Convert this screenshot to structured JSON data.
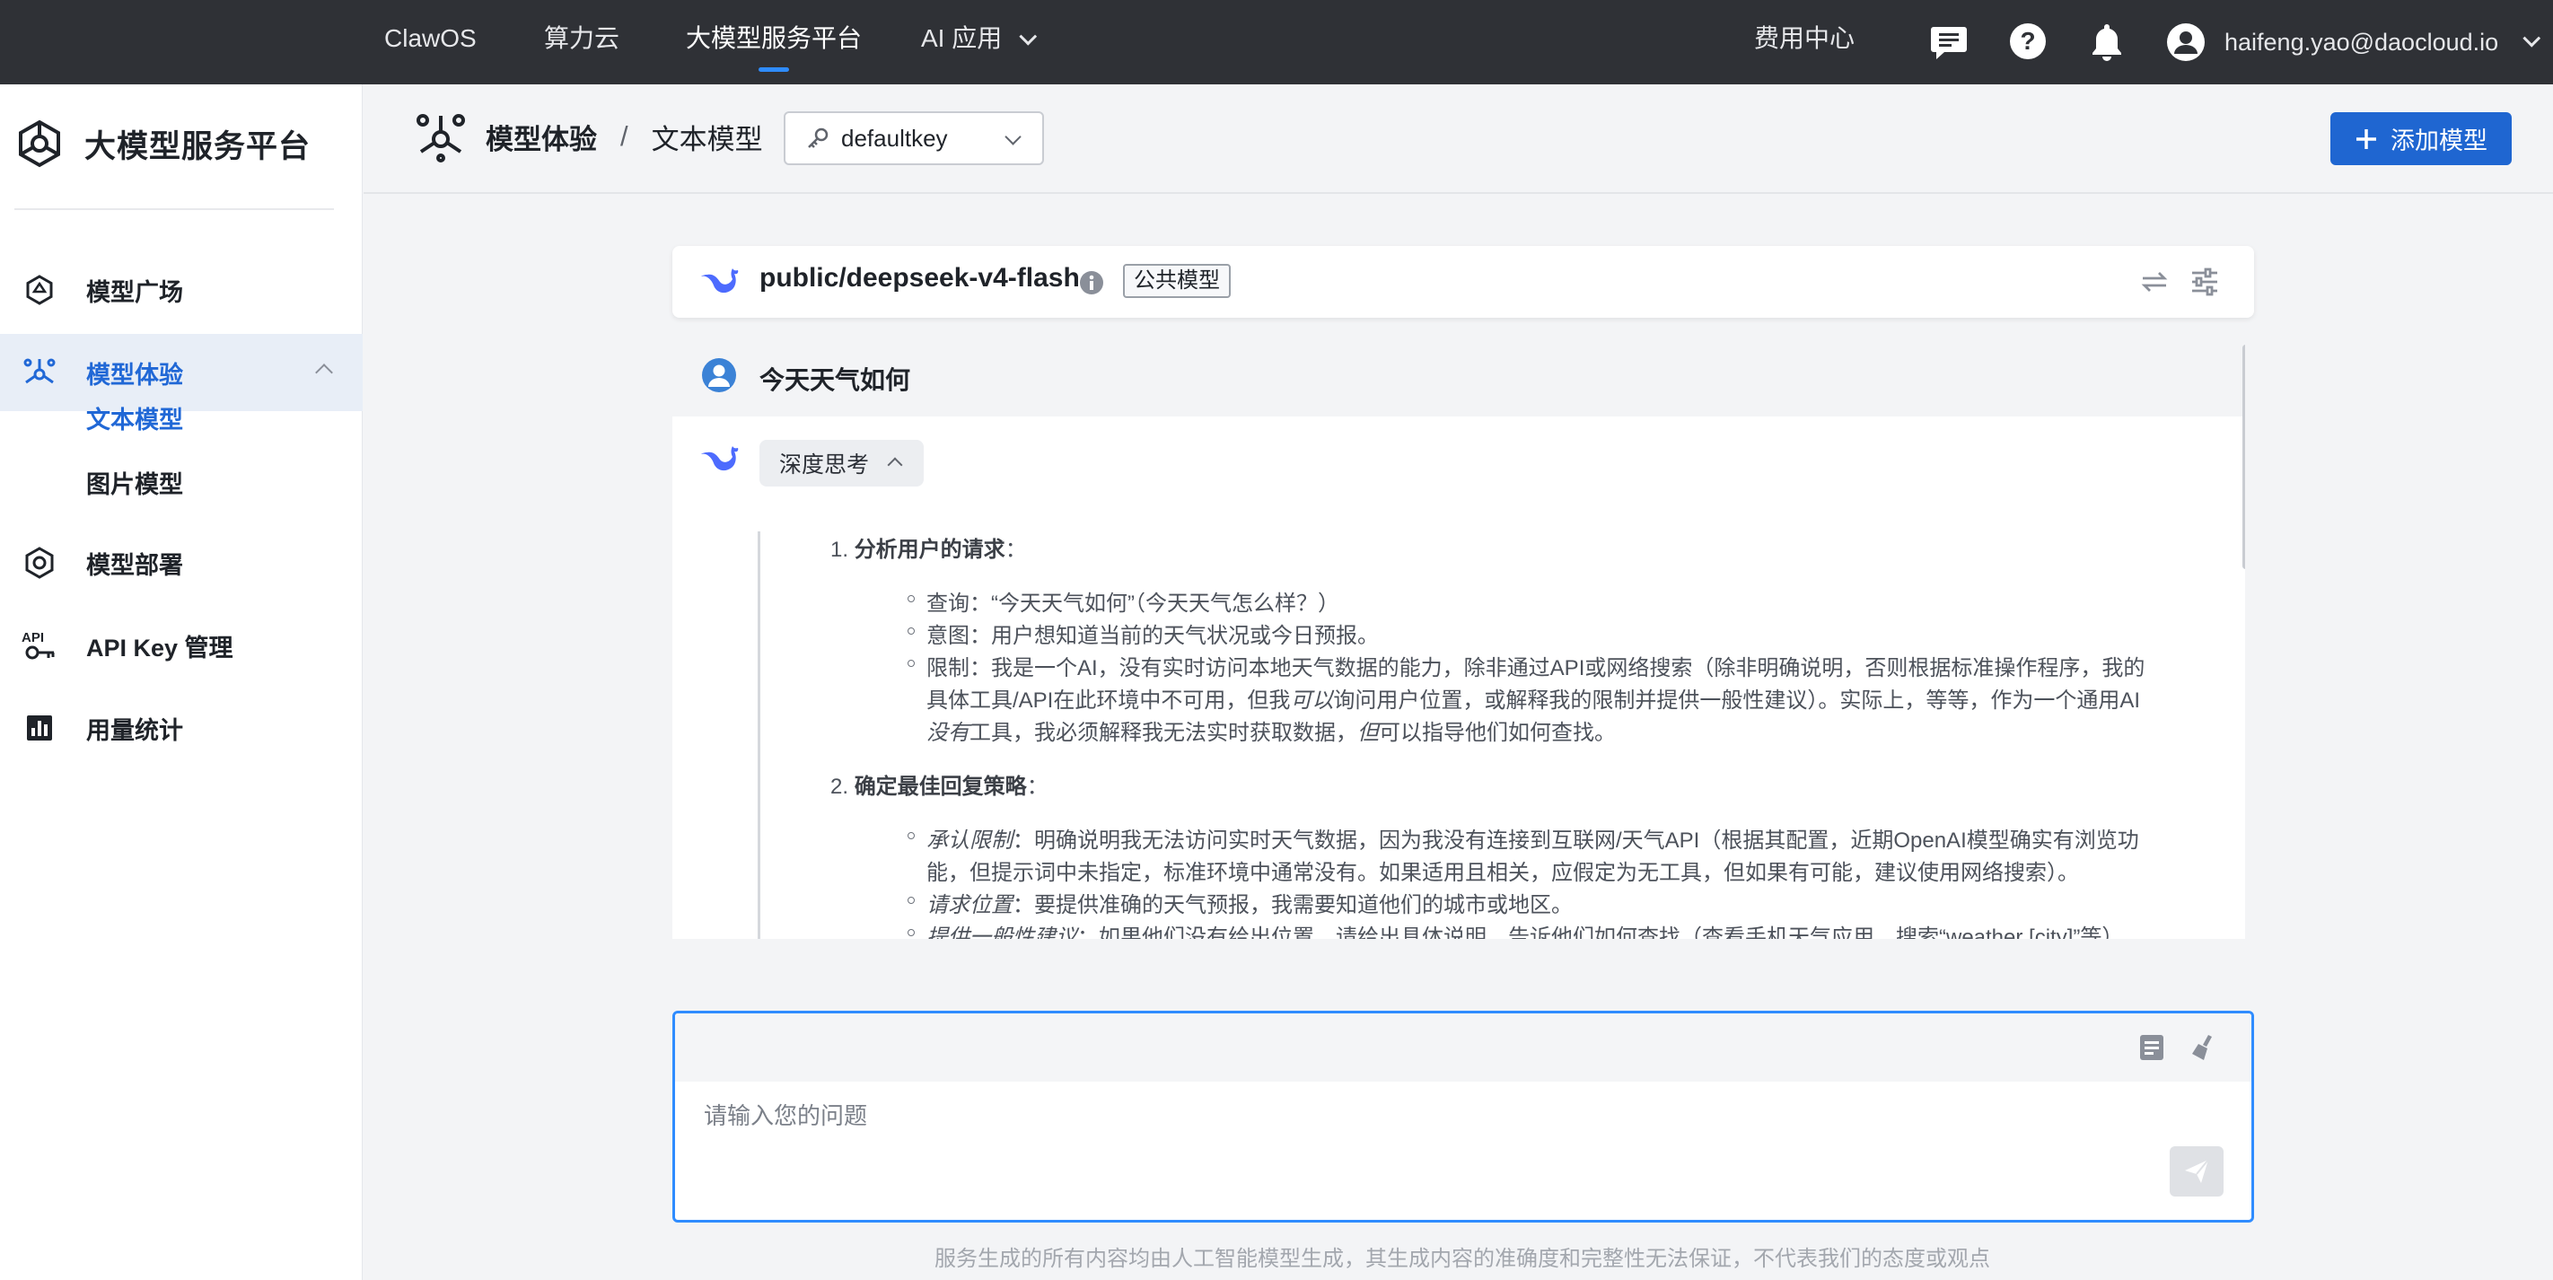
{
  "topnav": {
    "items": [
      "ClawOS",
      "算力云",
      "大模型服务平台",
      "AI 应用"
    ],
    "active_item": "大模型服务平台",
    "cost_center": "费用中心",
    "user_email": "haifeng.yao@daocloud.io",
    "icons": [
      "message-icon",
      "help-icon",
      "bell-icon",
      "user-avatar-icon"
    ]
  },
  "sidebar": {
    "brand": "大模型服务平台",
    "items": [
      {
        "label": "模型广场",
        "icon": "hexagon-icon"
      },
      {
        "label": "模型体验",
        "icon": "experience-icon",
        "expanded": true
      },
      {
        "label": "模型部署",
        "icon": "deploy-icon"
      },
      {
        "label": "API Key 管理",
        "icon": "api-key-icon"
      },
      {
        "label": "用量统计",
        "icon": "chart-icon"
      }
    ],
    "sub_items": [
      {
        "label": "文本模型",
        "active": true
      },
      {
        "label": "图片模型",
        "active": false
      }
    ]
  },
  "header": {
    "crumb_parent": "模型体验",
    "crumb_sep": "/",
    "crumb_current": "文本模型",
    "key_select_value": "defaultkey",
    "add_model_label": "添加模型"
  },
  "model": {
    "name": "public/deepseek-v4-flash",
    "badge": "公共模型"
  },
  "chat": {
    "user_message": "今天天气如何",
    "think_label": "深度思考",
    "section1_num": "1.",
    "section1_title": "分析用户的请求",
    "section1_colon": "：",
    "s1_b1": "查询：“今天天气如何”（今天天气怎么样？）",
    "s1_b2": "意图：用户想知道当前的天气状况或今日预报。",
    "s1_b3_l1": "限制：我是一个AI，没有实时访问本地天气数据的能力，除非通过API或网络搜索（除非明确说明，否则根据标准操作程序，我的",
    "s1_b3_l2a": "具体工具/API在此环境中不可用，但我",
    "s1_b3_l2b": "可以",
    "s1_b3_l2c": "询问用户位置，或解释我的限制并提供一般性建议）。实际上，等等，作为一个通用AI",
    "s1_b3_l3a": "没有",
    "s1_b3_l3b": "工具，我必须解释我无法实时获取数据，",
    "s1_b3_l3c": "但",
    "s1_b3_l3d": "可以指导他们如何查找。",
    "section2_num": "2.",
    "section2_title": "确定最佳回复策略",
    "section2_colon": "：",
    "s2_b1_em": "承认限制",
    "s2_b1_l1": "：明确说明我无法访问实时天气数据，因为我没有连接到互联网/天气API（根据其配置，近期OpenAI模型确实有浏览功",
    "s2_b1_l2": "能，但提示词中未指定，标准环境中通常没有。如果适用且相关，应假定为无工具，但如果有可能，建议使用网络搜索）。",
    "s2_b2_em": "请求位置",
    "s2_b2": "：要提供准确的天气预报，我需要知道他们的城市或地区。",
    "s2_b3_em": "提供一般性建议",
    "s2_b3": "：如果他们没有给出位置，请给出具体说明，告诉他们如何查找（查看手机天气应用、搜索“weather [city]”等）。"
  },
  "input": {
    "placeholder": "请输入您的问题"
  },
  "disclaimer": "服务生成的所有内容均由人工智能模型生成，其生成内容的准确度和完整性无法保证，不代表我们的态度或观点",
  "colors": {
    "topnav_bg": "#2f3136",
    "accent": "#1f66d1",
    "active_text": "#2168d6",
    "focus_border": "#2f8cff"
  }
}
